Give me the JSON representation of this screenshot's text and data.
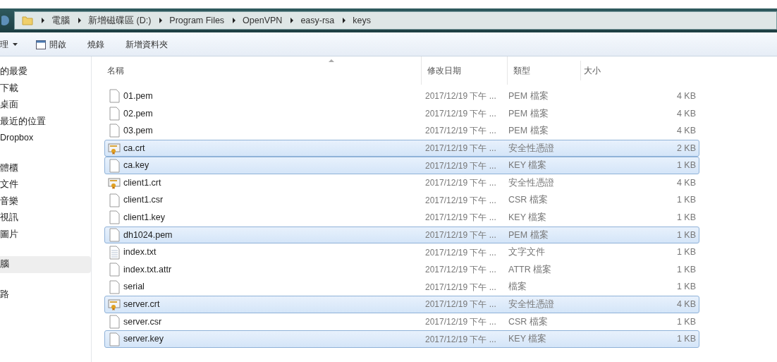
{
  "breadcrumbs": [
    "電腦",
    "新增磁碟區 (D:)",
    "Program Files",
    "OpenVPN",
    "easy-rsa",
    "keys"
  ],
  "toolbar": [
    {
      "label": "理",
      "kind": "menu"
    },
    {
      "label": "開啟",
      "kind": "open"
    },
    {
      "label": "燒錄",
      "kind": "plain"
    },
    {
      "label": "新增資料夾",
      "kind": "plain"
    }
  ],
  "sidebar": {
    "groups": [
      {
        "items": [
          {
            "label": "的最愛",
            "selected": false
          },
          {
            "label": "下載",
            "selected": false
          },
          {
            "label": "桌面",
            "selected": false
          },
          {
            "label": "最近的位置",
            "selected": false
          },
          {
            "label": "Dropbox",
            "selected": false
          }
        ]
      },
      {
        "items": [
          {
            "label": "體櫃",
            "selected": false
          },
          {
            "label": "文件",
            "selected": false
          },
          {
            "label": "音樂",
            "selected": false
          },
          {
            "label": "視訊",
            "selected": false
          },
          {
            "label": "圖片",
            "selected": false
          }
        ]
      },
      {
        "items": [
          {
            "label": "腦",
            "selected": true
          }
        ]
      },
      {
        "items": [
          {
            "label": "路",
            "selected": false
          }
        ]
      }
    ]
  },
  "table": {
    "columns": [
      "名稱",
      "修改日期",
      "類型",
      "大小"
    ],
    "rows": [
      {
        "name": "01.pem",
        "kind": "file",
        "date": "2017/12/19 下午 ...",
        "type": "PEM 檔案",
        "size": "4 KB",
        "selected": false
      },
      {
        "name": "02.pem",
        "kind": "file",
        "date": "2017/12/19 下午 ...",
        "type": "PEM 檔案",
        "size": "4 KB",
        "selected": false
      },
      {
        "name": "03.pem",
        "kind": "file",
        "date": "2017/12/19 下午 ...",
        "type": "PEM 檔案",
        "size": "4 KB",
        "selected": false
      },
      {
        "name": "ca.crt",
        "kind": "cert",
        "date": "2017/12/19 下午 ...",
        "type": "安全性憑證",
        "size": "2 KB",
        "selected": true
      },
      {
        "name": "ca.key",
        "kind": "file",
        "date": "2017/12/19 下午 ...",
        "type": "KEY 檔案",
        "size": "1 KB",
        "selected": true
      },
      {
        "name": "client1.crt",
        "kind": "cert",
        "date": "2017/12/19 下午 ...",
        "type": "安全性憑證",
        "size": "4 KB",
        "selected": false
      },
      {
        "name": "client1.csr",
        "kind": "file",
        "date": "2017/12/19 下午 ...",
        "type": "CSR 檔案",
        "size": "1 KB",
        "selected": false
      },
      {
        "name": "client1.key",
        "kind": "file",
        "date": "2017/12/19 下午 ...",
        "type": "KEY 檔案",
        "size": "1 KB",
        "selected": false
      },
      {
        "name": "dh1024.pem",
        "kind": "file",
        "date": "2017/12/19 下午 ...",
        "type": "PEM 檔案",
        "size": "1 KB",
        "selected": true
      },
      {
        "name": "index.txt",
        "kind": "text",
        "date": "2017/12/19 下午 ...",
        "type": "文字文件",
        "size": "1 KB",
        "selected": false
      },
      {
        "name": "index.txt.attr",
        "kind": "file",
        "date": "2017/12/19 下午 ...",
        "type": "ATTR 檔案",
        "size": "1 KB",
        "selected": false
      },
      {
        "name": "serial",
        "kind": "file",
        "date": "2017/12/19 下午 ...",
        "type": "檔案",
        "size": "1 KB",
        "selected": false
      },
      {
        "name": "server.crt",
        "kind": "cert",
        "date": "2017/12/19 下午 ...",
        "type": "安全性憑證",
        "size": "4 KB",
        "selected": true
      },
      {
        "name": "server.csr",
        "kind": "file",
        "date": "2017/12/19 下午 ...",
        "type": "CSR 檔案",
        "size": "1 KB",
        "selected": false
      },
      {
        "name": "server.key",
        "kind": "file",
        "date": "2017/12/19 下午 ...",
        "type": "KEY 檔案",
        "size": "1 KB",
        "selected": true
      }
    ]
  }
}
